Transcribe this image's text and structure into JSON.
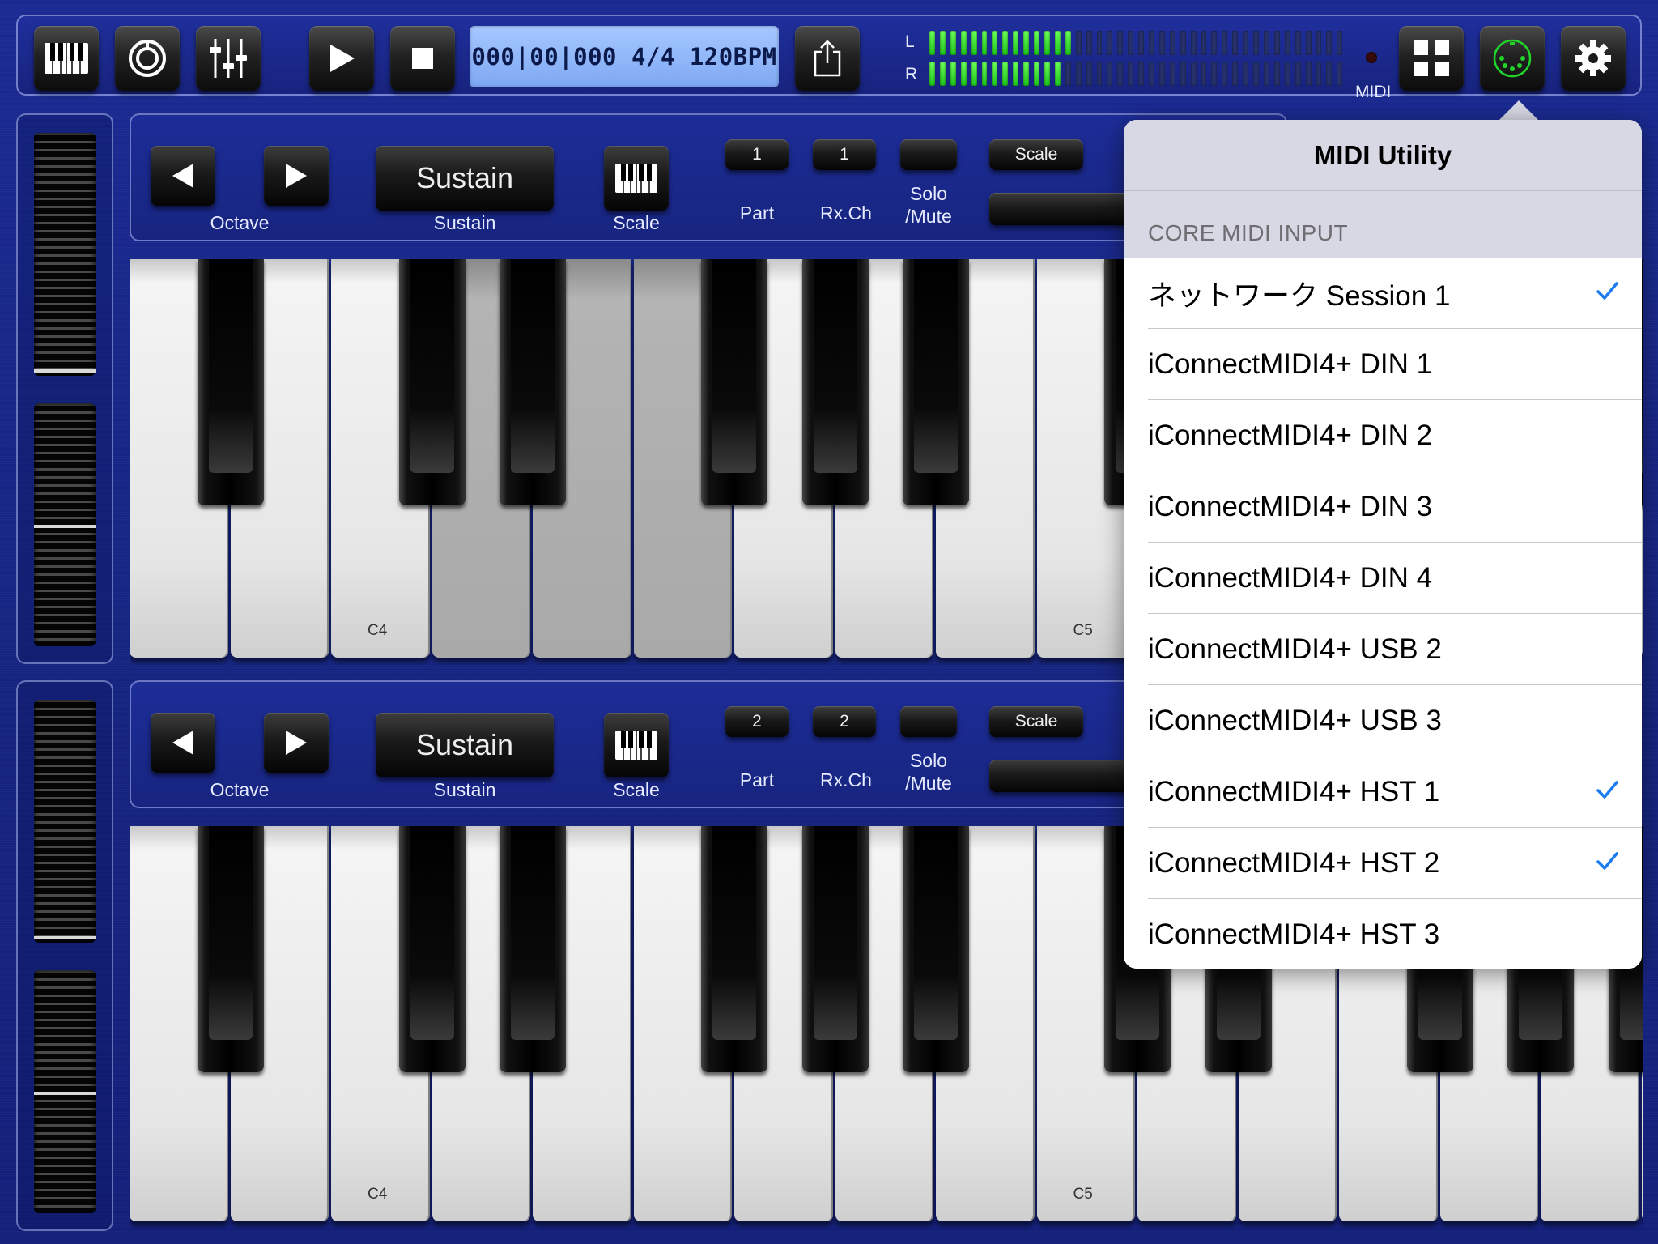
{
  "toolbar": {
    "buttons": [
      "keyboard-icon",
      "knob-icon",
      "mixer-icon",
      "play-icon",
      "stop-icon",
      "share-icon",
      "grid-icon",
      "midi-din-icon",
      "gear-icon"
    ],
    "time_display": "000|00|000 4/4 120BPM",
    "meter_left_label": "L",
    "meter_right_label": "R",
    "meter_left_level": 0.34,
    "meter_right_level": 0.32,
    "midi_label": "MIDI"
  },
  "parts": [
    {
      "octave_label": "Octave",
      "sustain_button": "Sustain",
      "sustain_label": "Sustain",
      "scale_label": "Scale",
      "part_value": "1",
      "part_label": "Part",
      "rxch_value": "1",
      "rxch_label": "Rx.Ch",
      "solo_label_1": "Solo",
      "solo_label_2": "/Mute",
      "scale_button": "Scale",
      "note_c4": "C4",
      "note_c5": "C5"
    },
    {
      "octave_label": "Octave",
      "sustain_button": "Sustain",
      "sustain_label": "Sustain",
      "scale_label": "Scale",
      "part_value": "2",
      "part_label": "Part",
      "rxch_value": "2",
      "rxch_label": "Rx.Ch",
      "solo_label_1": "Solo",
      "solo_label_2": "/Mute",
      "scale_button": "Scale",
      "note_c4": "C4",
      "note_c5": "C5"
    }
  ],
  "popover": {
    "title": "MIDI Utility",
    "section": "CORE MIDI INPUT",
    "items": [
      {
        "label": "ネットワーク Session 1",
        "checked": true
      },
      {
        "label": "iConnectMIDI4+ DIN 1",
        "checked": false
      },
      {
        "label": "iConnectMIDI4+ DIN 2",
        "checked": false
      },
      {
        "label": "iConnectMIDI4+ DIN 3",
        "checked": false
      },
      {
        "label": "iConnectMIDI4+ DIN 4",
        "checked": false
      },
      {
        "label": "iConnectMIDI4+ USB 2",
        "checked": false
      },
      {
        "label": "iConnectMIDI4+ USB 3",
        "checked": false
      },
      {
        "label": "iConnectMIDI4+ HST 1",
        "checked": true
      },
      {
        "label": "iConnectMIDI4+ HST 2",
        "checked": true
      },
      {
        "label": "iConnectMIDI4+ HST 3",
        "checked": false
      }
    ],
    "check_color": "#1a7cf0"
  }
}
